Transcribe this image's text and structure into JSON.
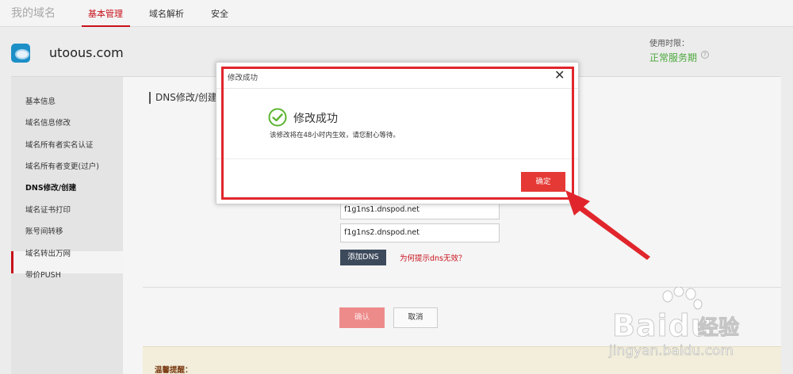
{
  "topnav": {
    "brand": "我的域名",
    "tabs": [
      {
        "label": "基本管理",
        "active": true
      },
      {
        "label": "域名解析",
        "active": false
      },
      {
        "label": "安全",
        "active": false
      }
    ]
  },
  "domain": {
    "name": "utoous.com",
    "period_label": "使用时限：",
    "period_value": "正常服务期"
  },
  "sidebar": {
    "items": [
      {
        "label": "基本信息"
      },
      {
        "label": "域名信息修改"
      },
      {
        "label": "域名所有者实名认证"
      },
      {
        "label": "域名所有者变更(过户)"
      },
      {
        "label": "DNS修改/创建",
        "active": true
      },
      {
        "label": "域名证书打印"
      },
      {
        "label": "账号间转移"
      },
      {
        "label": "域名转出万网"
      },
      {
        "label": "带价PUSH"
      }
    ]
  },
  "main": {
    "section_title": "DNS修改/创建",
    "dns_inputs": [
      "f1g1ns1.dnspod.net",
      "f1g1ns2.dnspod.net"
    ],
    "add_dns_label": "添加DNS",
    "dns_help_link": "为何提示dns无效？",
    "confirm_label": "确认",
    "cancel_label": "取消",
    "tip_title": "温馨提醒："
  },
  "modal": {
    "title": "修改成功",
    "success_title": "修改成功",
    "success_desc": "该修改将在48小时内生效，请您耐心等待。",
    "ok_label": "确定"
  },
  "watermark": {
    "brand": "Bai",
    "brand_suffix": "du",
    "cn": "经验",
    "url": "jingyan.baidu.com"
  },
  "colors": {
    "accent_red": "#c8101a",
    "success_green": "#4ba83d",
    "annotation_red": "#e0262c"
  }
}
